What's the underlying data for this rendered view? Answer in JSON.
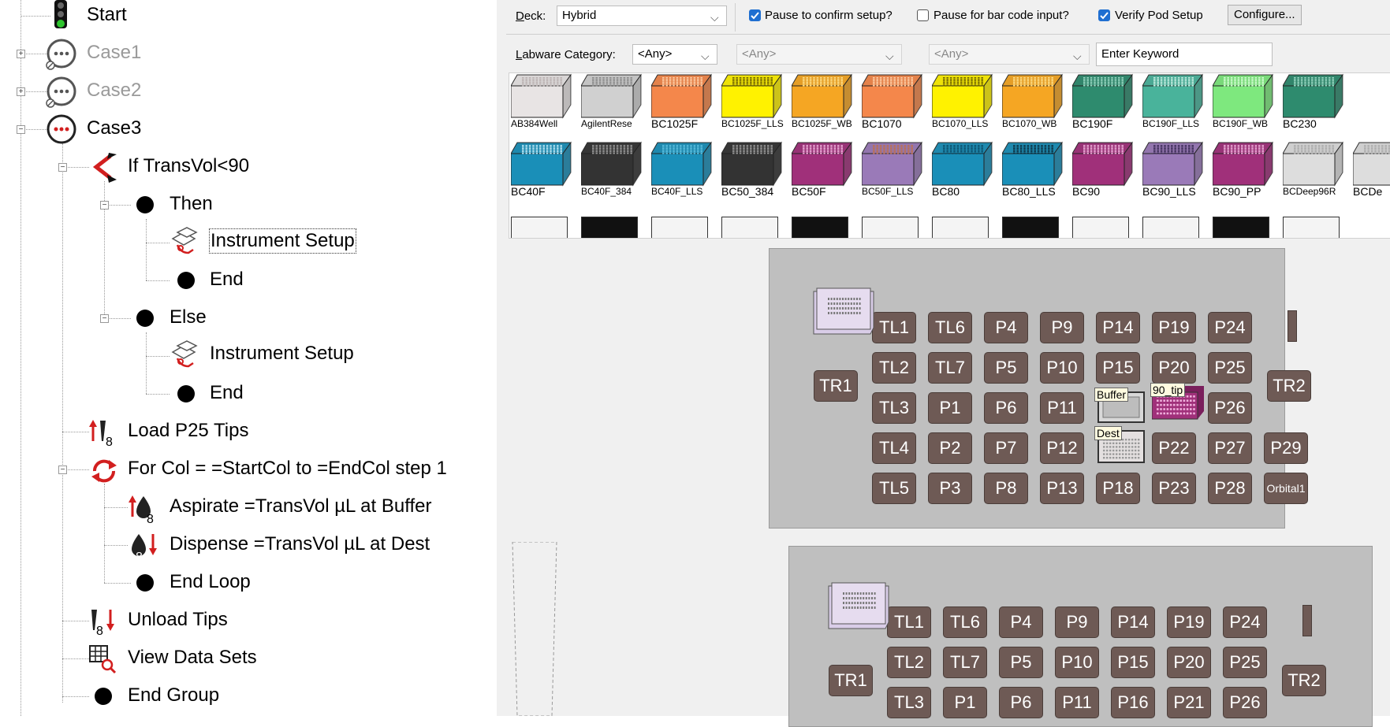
{
  "tree": {
    "nodes": [
      {
        "label": "Start"
      },
      {
        "label": "Case1"
      },
      {
        "label": "Case2"
      },
      {
        "label": "Case3"
      },
      {
        "label": "If TransVol<90"
      },
      {
        "label": "Then"
      },
      {
        "label": "Instrument Setup"
      },
      {
        "label": "End"
      },
      {
        "label": "Else"
      },
      {
        "label": "Instrument Setup"
      },
      {
        "label": "End"
      },
      {
        "label": "Load P25 Tips"
      },
      {
        "label": "For Col = =StartCol to =EndCol step 1"
      },
      {
        "label": "Aspirate =TransVol µL at Buffer"
      },
      {
        "label": "Dispense =TransVol µL at Dest"
      },
      {
        "label": "End Loop"
      },
      {
        "label": "Unload Tips"
      },
      {
        "label": "View Data Sets"
      },
      {
        "label": "End Group"
      }
    ],
    "icon_text": {
      "tip_count": "8"
    }
  },
  "toolbar": {
    "deck_label_u": "D",
    "deck_label_rest": "eck:",
    "deck_value": "Hybrid",
    "pause_confirm_label": "Pause to confirm setup?",
    "pause_confirm_checked": true,
    "pause_barcode_label": "Pause for bar code input?",
    "pause_barcode_checked": false,
    "verify_pod_label": "Verify Pod Setup",
    "verify_pod_checked": true,
    "configure_label": "Configure..."
  },
  "filter": {
    "category_label_u": "L",
    "category_label_rest": "abware Category:",
    "category_value": "<Any>",
    "select2_value": "<Any>",
    "select3_value": "<Any>",
    "keyword_value": "Enter Keyword"
  },
  "gallery": {
    "row1": [
      {
        "name": "AB384Well",
        "color": "#e8e4e4",
        "grid": "#b9b0b0"
      },
      {
        "name": "AgilentRese",
        "color": "#d0d0d0",
        "grid": "#888888"
      },
      {
        "name": "BC1025F",
        "color": "#f4874b",
        "grid": "#ffd0a8"
      },
      {
        "name": "BC1025F_LLS",
        "color": "#fff200",
        "grid": "#6b6000"
      },
      {
        "name": "BC1025F_WB",
        "color": "#f5a623",
        "grid": "#ffe08a"
      },
      {
        "name": "BC1070",
        "color": "#f4874b",
        "grid": "#ffd0a8"
      },
      {
        "name": "BC1070_LLS",
        "color": "#fff200",
        "grid": "#6b6000"
      },
      {
        "name": "BC1070_WB",
        "color": "#f5a623",
        "grid": "#ffe08a"
      },
      {
        "name": "BC190F",
        "color": "#2e8b6e",
        "grid": "#9ad9c3"
      },
      {
        "name": "BC190F_LLS",
        "color": "#49b39b",
        "grid": "#c8f0e4"
      },
      {
        "name": "BC190F_WB",
        "color": "#7ee87e",
        "grid": "#d4ffd4"
      },
      {
        "name": "BC230",
        "color": "#2e8b6e",
        "grid": "#9ad9c3"
      }
    ],
    "row2": [
      {
        "name": "BC40F",
        "color": "#1a8fb8",
        "grid": "#bfe9f7"
      },
      {
        "name": "BC40F_384",
        "color": "#333333",
        "grid": "#9a9a9a"
      },
      {
        "name": "BC40F_LLS",
        "color": "#1a8fb8",
        "grid": "#5cc0e0"
      },
      {
        "name": "BC50_384",
        "color": "#333333",
        "grid": "#9a9a9a"
      },
      {
        "name": "BC50F",
        "color": "#a0307a",
        "grid": "#f0b0dc"
      },
      {
        "name": "BC50F_LLS",
        "color": "#9a7ab8",
        "grid": "#c06f4a"
      },
      {
        "name": "BC80",
        "color": "#1a8fb8",
        "grid": "#0b4f6b"
      },
      {
        "name": "BC80_LLS",
        "color": "#1a8fb8",
        "grid": "#0b2f3f"
      },
      {
        "name": "BC90",
        "color": "#a0307a",
        "grid": "#f0b0dc"
      },
      {
        "name": "BC90_LLS",
        "color": "#9a7ab8",
        "grid": "#3a2a55"
      },
      {
        "name": "BC90_PP",
        "color": "#a0307a",
        "grid": "#f0b0dc"
      },
      {
        "name": "BCDeep96R",
        "color": "#dddddd",
        "grid": "#aaaaaa"
      },
      {
        "name": "BCDe",
        "color": "#dddddd",
        "grid": "#aaaaaa"
      }
    ]
  },
  "deck1": {
    "rows": [
      [
        "TL1",
        "TL6",
        "P4",
        "P9",
        "P14",
        "P19",
        "P24"
      ],
      [
        "TL2",
        "TL7",
        "P5",
        "P10",
        "P15",
        "P20",
        "P25"
      ],
      [
        "TL3",
        "P1",
        "P6",
        "P11",
        "",
        "",
        "P26"
      ],
      [
        "TL4",
        "P2",
        "P7",
        "P12",
        "",
        "P22",
        "P27",
        "P29"
      ],
      [
        "TL5",
        "P3",
        "P8",
        "P13",
        "P18",
        "P23",
        "P28",
        "Orbital1"
      ]
    ],
    "tr1": "TR1",
    "tr2": "TR2",
    "buffer_label": "Buffer",
    "tip_label": "90_tip",
    "dest_label": "Dest"
  },
  "deck2": {
    "rows": [
      [
        "TL1",
        "TL6",
        "P4",
        "P9",
        "P14",
        "P19",
        "P24"
      ],
      [
        "TL2",
        "TL7",
        "P5",
        "P10",
        "P15",
        "P20",
        "P25"
      ],
      [
        "TL3",
        "P1",
        "P6",
        "P11",
        "P16",
        "P21",
        "P26"
      ]
    ],
    "tr1": "TR1",
    "tr2": "TR2"
  }
}
